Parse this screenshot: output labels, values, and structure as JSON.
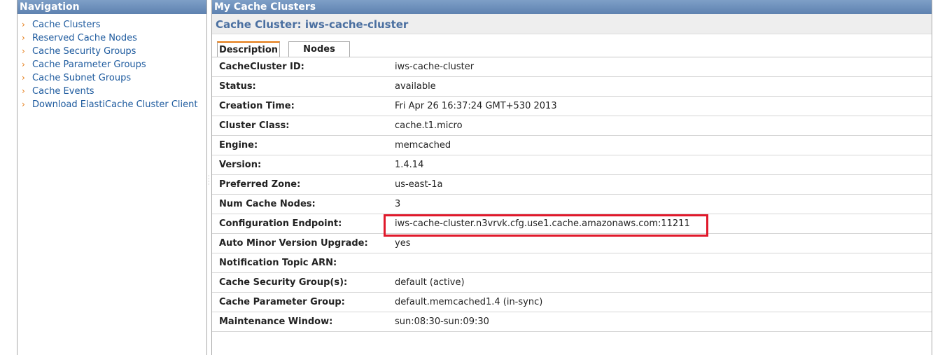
{
  "navigation": {
    "title": "Navigation",
    "items": [
      {
        "label": "Cache Clusters"
      },
      {
        "label": "Reserved Cache Nodes"
      },
      {
        "label": "Cache Security Groups"
      },
      {
        "label": "Cache Parameter Groups"
      },
      {
        "label": "Cache Subnet Groups"
      },
      {
        "label": "Cache Events"
      },
      {
        "label": "Download ElastiCache Cluster Client"
      }
    ]
  },
  "main": {
    "title": "My Cache Clusters",
    "cluster_title": "Cache Cluster: iws-cache-cluster",
    "tabs": [
      {
        "label": "Description",
        "active": true
      },
      {
        "label": "Nodes",
        "active": false
      }
    ],
    "details": [
      {
        "label": "CacheCluster ID:",
        "value": "iws-cache-cluster"
      },
      {
        "label": "Status:",
        "value": "available"
      },
      {
        "label": "Creation Time:",
        "value": "Fri Apr 26 16:37:24 GMT+530 2013"
      },
      {
        "label": "Cluster Class:",
        "value": "cache.t1.micro"
      },
      {
        "label": "Engine:",
        "value": "memcached"
      },
      {
        "label": "Version:",
        "value": "1.4.14"
      },
      {
        "label": "Preferred Zone:",
        "value": "us-east-1a"
      },
      {
        "label": "Num Cache Nodes:",
        "value": "3"
      },
      {
        "label": "Configuration Endpoint:",
        "value": "iws-cache-cluster.n3vrvk.cfg.use1.cache.amazonaws.com:11211"
      },
      {
        "label": "Auto Minor Version Upgrade:",
        "value": "yes"
      },
      {
        "label": "Notification Topic ARN:",
        "value": ""
      },
      {
        "label": "Cache Security Group(s):",
        "value": "default (active)"
      },
      {
        "label": "Cache Parameter Group:",
        "value": "default.memcached1.4 (in-sync)"
      },
      {
        "label": "Maintenance Window:",
        "value": "sun:08:30-sun:09:30"
      }
    ]
  },
  "colors": {
    "header_blue": "#6a8dbb",
    "link_blue": "#1d5a9e",
    "bullet_orange": "#e47911",
    "highlight_red": "#e0192b"
  }
}
